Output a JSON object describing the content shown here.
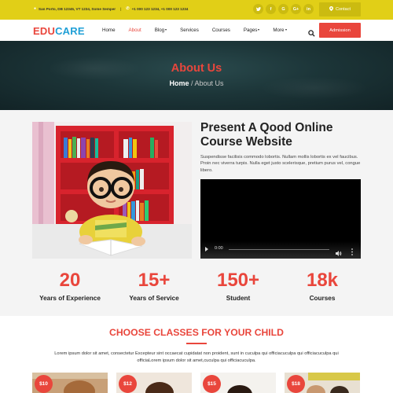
{
  "topbar": {
    "address": "San Porto, DB 12345, VT 1234, Some Semper",
    "phone": "+1 000 123 1234, +1 000 123 1234",
    "socials": [
      "tw",
      "f",
      "G",
      "G+",
      "in"
    ],
    "contact_label": "Contact"
  },
  "nav": {
    "logo_part1": "EDU",
    "logo_part2": "CARE",
    "items": [
      {
        "label": "Home"
      },
      {
        "label": "About"
      },
      {
        "label": "Blog"
      },
      {
        "label": "Services"
      },
      {
        "label": "Courses"
      },
      {
        "label": "Pages"
      },
      {
        "label": "More"
      }
    ],
    "admission_label": "Admission"
  },
  "banner": {
    "title": "About Us",
    "crumb_home": "Home",
    "crumb_sep": " / ",
    "crumb_current": "About Us"
  },
  "about": {
    "title": "Present A Qood Online Course Website",
    "text": "Suspendisse facilisis commodo lobortis. Nullam mollis lobortis ex vel faucibus. Proin nec viverra turpis. Nulla eget justo scelerisque, pretium purus vel, congue libero.",
    "video_time": "0:00"
  },
  "stats": [
    {
      "number": "20",
      "label": "Years of Experience"
    },
    {
      "number": "15+",
      "label": "Years of Service"
    },
    {
      "number": "150+",
      "label": "Student"
    },
    {
      "number": "18k",
      "label": "Courses"
    }
  ],
  "classes": {
    "title": "CHOOSE CLASSES FOR YOUR CHILD",
    "text": "Lorem ipsum dolor sit amet, consectetur Excepteur sint occaecat cupidatat non proident, sunt in cuculpa qui officiacuculpa qui officiacuculpa qui officiaLorem ipsum dolor sit amet,cuculpa qui officiacuculpa.",
    "cards": [
      {
        "price": "$10"
      },
      {
        "price": "$12"
      },
      {
        "price": "$15"
      },
      {
        "price": "$18"
      }
    ]
  },
  "colors": {
    "accent": "#e9463c",
    "topbar": "#e1cf17",
    "logo_blue": "#1f9fd6"
  }
}
